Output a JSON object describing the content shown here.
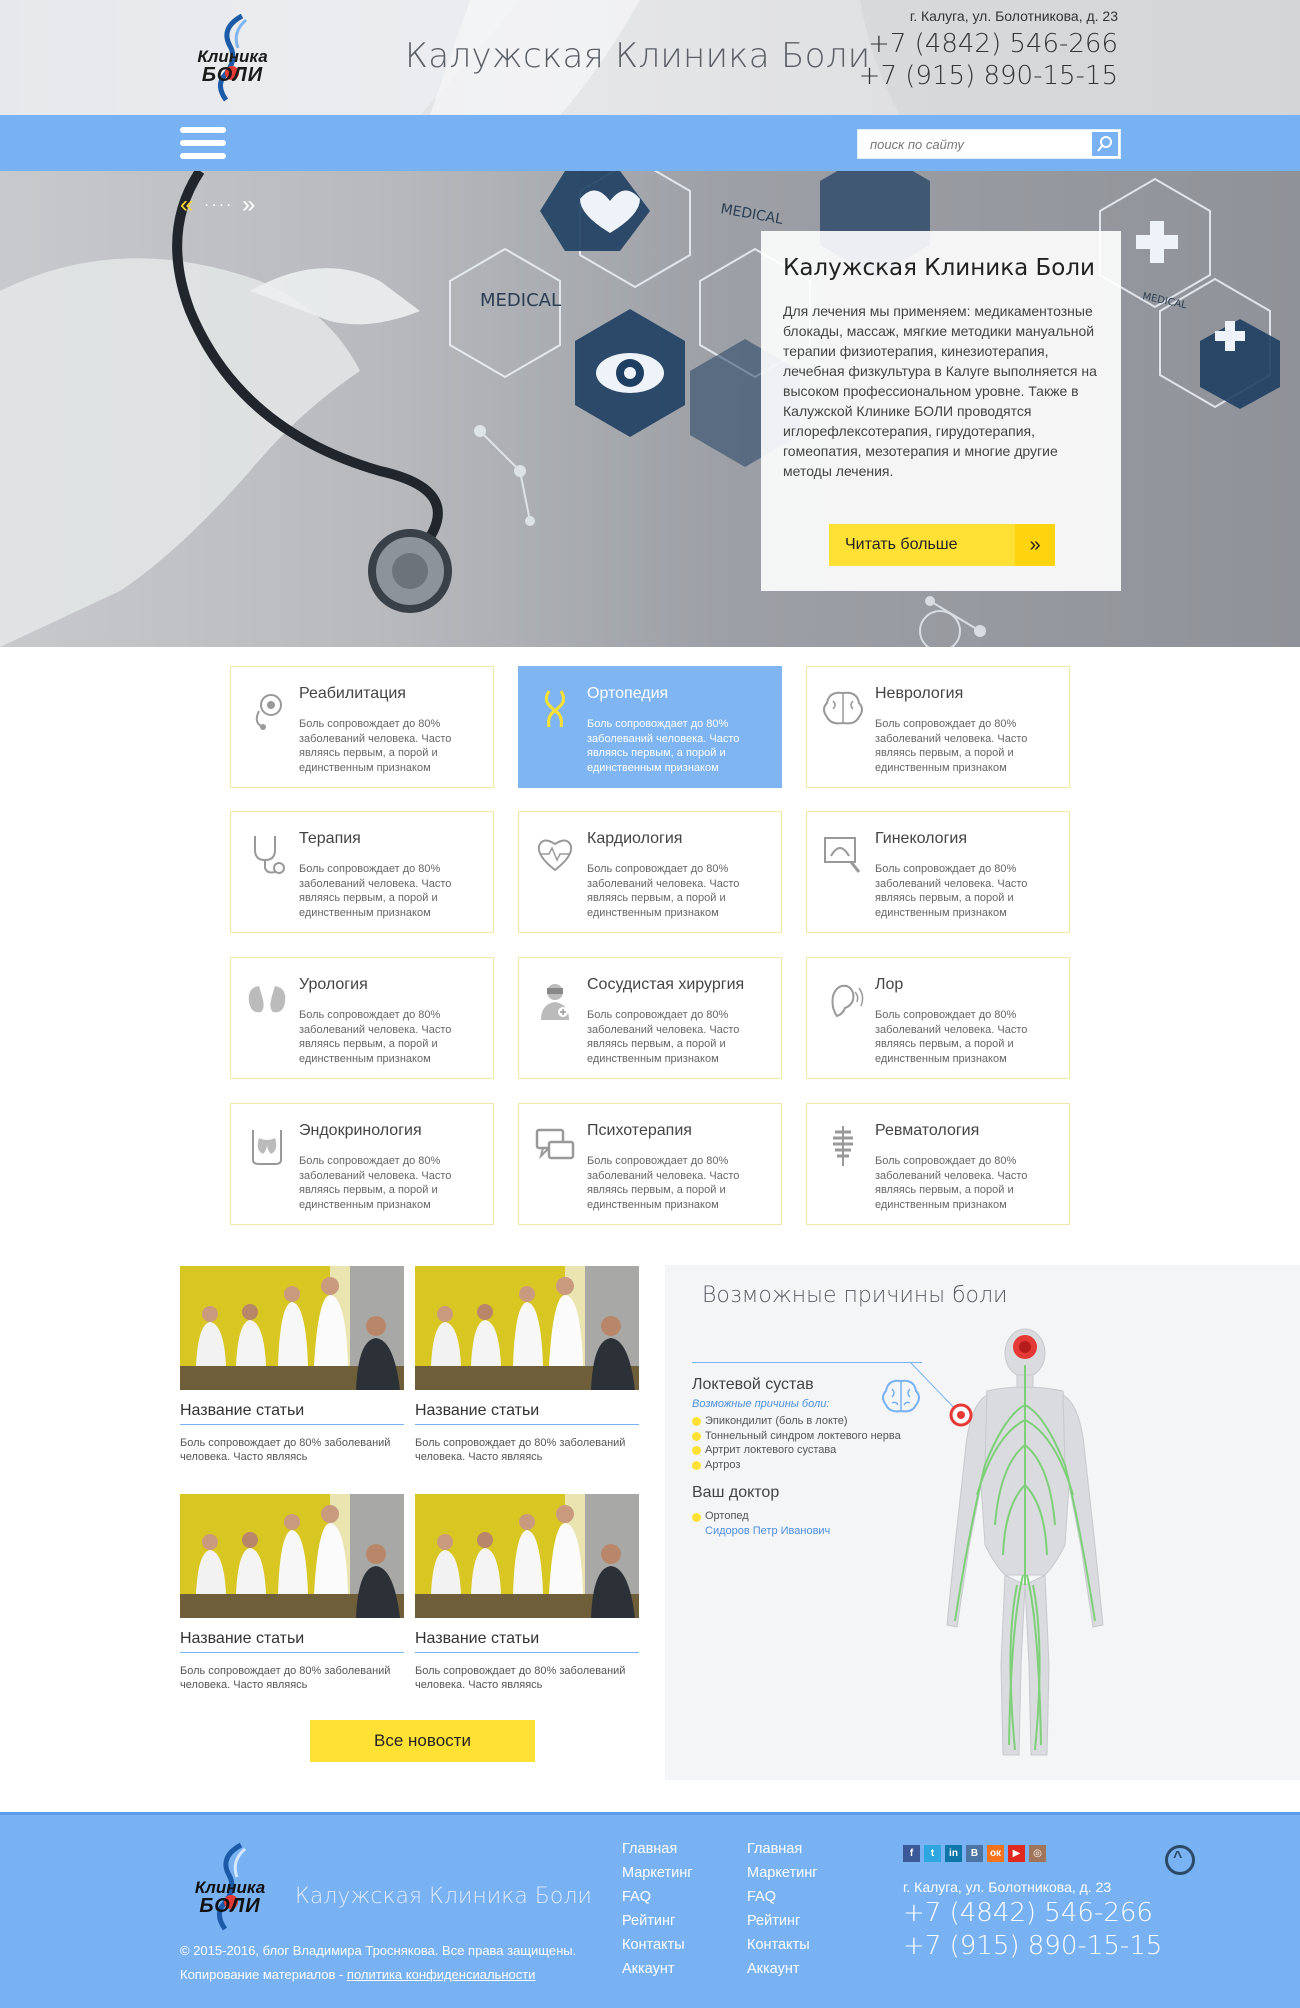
{
  "header": {
    "logo_line1": "Клиника",
    "logo_line2": "БОЛИ",
    "title": "Калужская Клиника Боли",
    "address": "г. Калуга, ул. Болотникова, д. 23",
    "phone1": "+7 (4842) 546-266",
    "phone2": "+7 (915) 890-15-15"
  },
  "nav": {
    "search_placeholder": "поиск по сайту",
    "menu_icon": "hamburger-icon",
    "search_icon": "search-icon"
  },
  "hero": {
    "prev": "«",
    "dots": "····",
    "next": "»",
    "card_title": "Калужская Клиника Боли",
    "card_text": "Для лечения мы применяем: медикаментозные блокады, массаж, мягкие методики мануальной терапии физиотерапия, кинезиотерапия, лечебная физкультура в Калуге выполняется на высоком профессиональном уровне. Также в Калужской Клинике БОЛИ проводятся иглорефлексотерапия, гирудотерапия, гомеопатия, мезотерапия и многие другие методы лечения.",
    "read_more": "Читать больше",
    "read_more_arrow": "»",
    "art_labels": {
      "medical": "MEDICAL"
    }
  },
  "services": [
    {
      "title": "Реабилитация",
      "desc": "Боль сопровождает до 80% заболеваний человека. Часто являясь первым, а порой и единственным признаком",
      "icon": "rehab-icon",
      "active": false
    },
    {
      "title": "Ортопедия",
      "desc": "Боль сопровождает до 80% заболеваний человека. Часто являясь первым, а порой и единственным признаком",
      "icon": "joint-icon",
      "active": true
    },
    {
      "title": "Неврология",
      "desc": "Боль сопровождает до 80% заболеваний человека. Часто являясь первым, а порой и единственным признаком",
      "icon": "brain-icon",
      "active": false
    },
    {
      "title": "Терапия",
      "desc": "Боль сопровождает до 80% заболеваний человека. Часто являясь первым, а порой и единственным признаком",
      "icon": "stethoscope-icon",
      "active": false
    },
    {
      "title": "Кардиология",
      "desc": "Боль сопровождает до 80% заболеваний человека. Часто являясь первым, а порой и единственным признаком",
      "icon": "heart-pulse-icon",
      "active": false
    },
    {
      "title": "Гинекология",
      "desc": "Боль сопровождает до 80% заболеваний человека. Часто являясь первым, а порой и единственным признаком",
      "icon": "ultrasound-icon",
      "active": false
    },
    {
      "title": "Урология",
      "desc": "Боль сопровождает до 80% заболеваний человека. Часто являясь первым, а порой и единственным признаком",
      "icon": "kidney-icon",
      "active": false
    },
    {
      "title": "Сосудистая хирургия",
      "desc": "Боль сопровождает до 80% заболеваний человека. Часто являясь первым, а порой и единственным признаком",
      "icon": "surgeon-icon",
      "active": false
    },
    {
      "title": "Лор",
      "desc": "Боль сопровождает до 80% заболеваний человека. Часто являясь первым, а порой и единственным признаком",
      "icon": "ear-icon",
      "active": false
    },
    {
      "title": "Эндокринология",
      "desc": "Боль сопровождает до 80% заболеваний человека. Часто являясь первым, а порой и единственным признаком",
      "icon": "thyroid-icon",
      "active": false
    },
    {
      "title": "Психотерапия",
      "desc": "Боль сопровождает до 80% заболеваний человека. Часто являясь первым, а порой и единственным признаком",
      "icon": "dialog-icon",
      "active": false
    },
    {
      "title": "Ревматология",
      "desc": "Боль сопровождает до 80% заболеваний человека. Часто являясь первым, а порой и единственным признаком",
      "icon": "spine-icon",
      "active": false
    }
  ],
  "news": {
    "articles": [
      {
        "title": "Название статьи",
        "desc": "Боль сопровождает до 80% заболеваний человека. Часто являясь"
      },
      {
        "title": "Название статьи",
        "desc": "Боль сопровождает до 80% заболеваний человека. Часто являясь"
      },
      {
        "title": "Название статьи",
        "desc": "Боль сопровождает до 80% заболеваний человека. Часто являясь"
      },
      {
        "title": "Название статьи",
        "desc": "Боль сопровождает до 80% заболеваний человека. Часто являясь"
      }
    ],
    "all_news": "Все новости"
  },
  "pain": {
    "title": "Возможные причины боли",
    "joint": "Локтевой сустав",
    "causes_label": "Возможные причины боли:",
    "causes": [
      "Эпикондилит (боль в локте)",
      "Тоннельный синдром локтевого нерва",
      "Артрит локтевого сустава",
      "Артроз"
    ],
    "doctor_heading": "Ваш доктор",
    "doctor_spec": "Ортопед",
    "doctor_name": "Сидоров Петр Иванович"
  },
  "footer": {
    "logo_line1": "Клиника",
    "logo_line2": "БОЛИ",
    "title": "Калужская Клиника Боли",
    "copyright": "© 2015-2016, блог Владимира Троснякова. Все права защищены.",
    "copy_prefix": "Копирование материалов - ",
    "policy": "политика конфиденсиальности",
    "menu1": [
      "Главная",
      "Маркетинг",
      "FAQ",
      "Рейтинг",
      "Контакты",
      "Аккаунт"
    ],
    "menu2": [
      "Главная",
      "Маркетинг",
      "FAQ",
      "Рейтинг",
      "Контакты",
      "Аккаунт"
    ],
    "socials": [
      {
        "label": "f",
        "color": "#3b5998",
        "icon": "facebook-icon"
      },
      {
        "label": "t",
        "color": "#2ea7e0",
        "icon": "twitter-icon"
      },
      {
        "label": "in",
        "color": "#0e76a8",
        "icon": "linkedin-icon"
      },
      {
        "label": "В",
        "color": "#4c75a3",
        "icon": "vk-icon"
      },
      {
        "label": "ок",
        "color": "#f4731c",
        "icon": "odnoklassniki-icon"
      },
      {
        "label": "▶",
        "color": "#e02a20",
        "icon": "youtube-icon"
      },
      {
        "label": "◎",
        "color": "#a1755c",
        "icon": "instagram-icon"
      }
    ],
    "up_arrow": "^",
    "address": "г. Калуга, ул. Болотникова, д. 23",
    "phone1": "+7 (4842) 546-266",
    "phone2": "+7 (915) 890-15-15"
  },
  "colors": {
    "accent_blue": "#79b2f3",
    "accent_yellow": "#ffe135",
    "active_card": "#7fb5f2"
  }
}
